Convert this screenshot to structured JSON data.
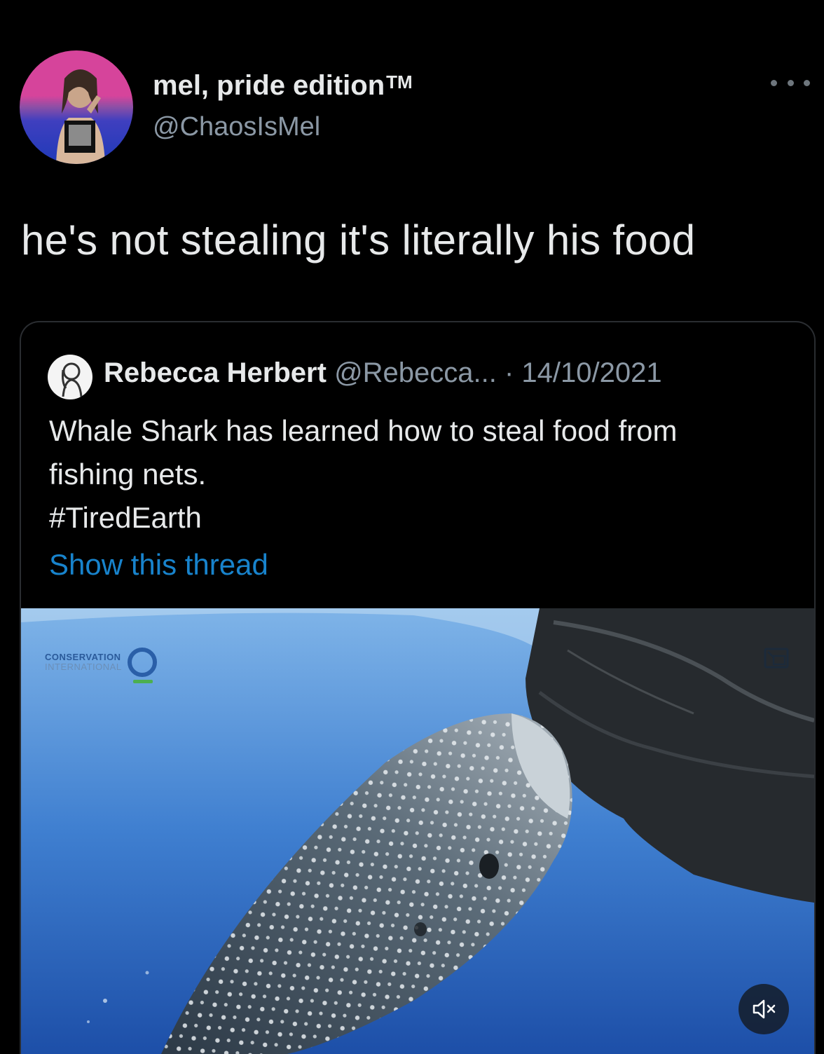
{
  "tweet": {
    "display_name": "mel, pride edition",
    "trademark": "TM",
    "handle": "@ChaosIsMel",
    "text": "he's not stealing it's literally his food",
    "more_icon": "more-dots-icon"
  },
  "quote": {
    "name": "Rebecca Herbert",
    "meta": "@Rebecca... · 14/10/2021",
    "body_lines": [
      "Whale Shark has learned how to steal food from",
      "fishing nets.",
      "#TiredEarth"
    ],
    "show_thread": "Show this thread",
    "media": {
      "watermark_line1": "CONSERVATION",
      "watermark_line2": "INTERNATIONAL",
      "icons": [
        "picture-in-picture-icon",
        "mute-icon"
      ]
    }
  },
  "colors": {
    "background": "#000000",
    "text": "#e7e9ea",
    "muted": "#8b98a5",
    "link": "#1d9bf0"
  }
}
